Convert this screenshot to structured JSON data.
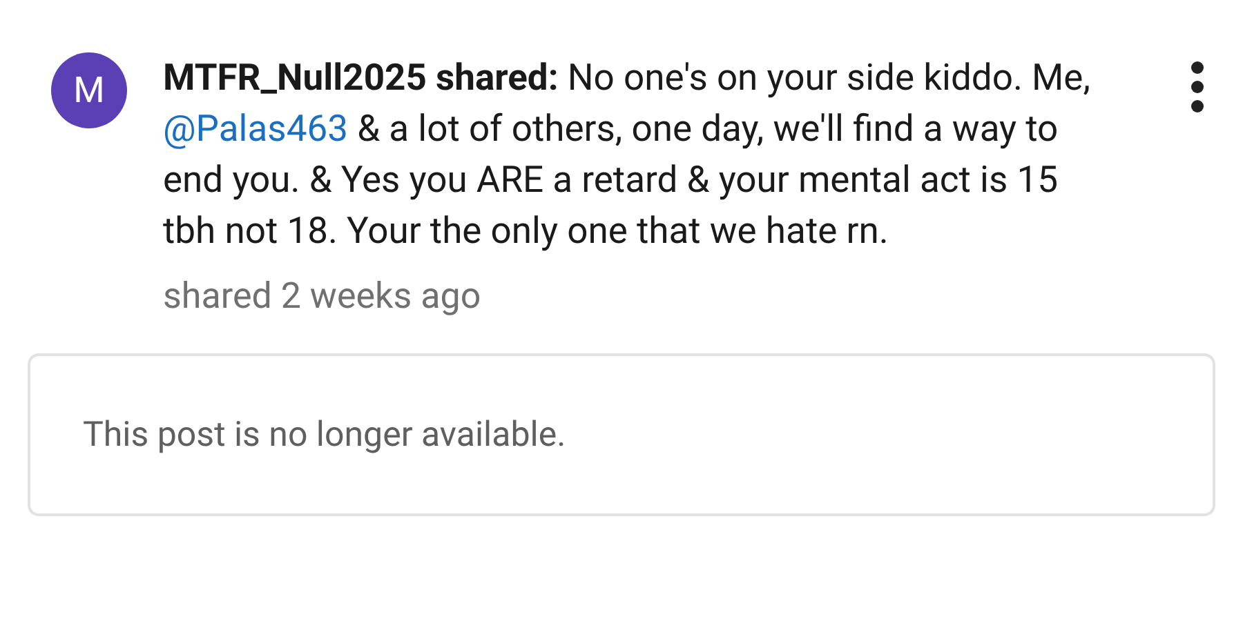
{
  "post": {
    "avatar_letter": "M",
    "author": "MTFR_Null2025 shared:",
    "text_before": "No one's on your side kiddo. Me,",
    "mention": "@Palas463",
    "text_after": "& a lot of others, one day, we'll find a way to end you. & Yes you ARE a retard & your mental act is 15 tbh not 18. Your the only one that we hate rn.",
    "timestamp": "shared 2 weeks ago"
  },
  "embedded_post": {
    "message": "This post is no longer available."
  }
}
